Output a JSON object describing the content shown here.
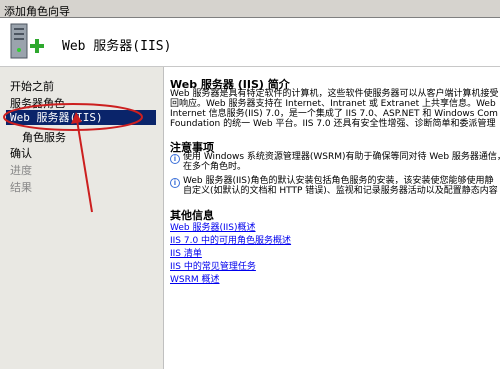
{
  "window": {
    "title": "添加角色向导"
  },
  "header": {
    "title": "Web 服务器(IIS)"
  },
  "sidebar": {
    "items": [
      {
        "label": "开始之前"
      },
      {
        "label": "服务器角色"
      },
      {
        "label": "Web 服务器(IIS)"
      },
      {
        "label": "角色服务"
      },
      {
        "label": "确认"
      },
      {
        "label": "进度"
      },
      {
        "label": "结果"
      }
    ]
  },
  "main": {
    "intro_title": "Web 服务器 (IIS) 简介",
    "intro_lines": [
      "Web 服务器是具有特定软件的计算机，这些软件使服务器可以从客户端计算机接受",
      "回响应。Web 服务器支持在 Internet、Intranet 或 Extranet 上共享信息。Web",
      "Internet 信息服务(IIS) 7.0，是一个集成了 IIS 7.0、ASP.NET 和 Windows Com",
      "Foundation 的统一 Web 平台。IIS 7.0 还具有安全性增强、诊断简单和委派管理"
    ],
    "notes_title": "注意事项",
    "notes": [
      {
        "lines": [
          "使用 Windows 系统资源管理器(WSRM)有助于确保等同对待 Web 服务器通信，",
          "在多个角色时。"
        ]
      },
      {
        "lines": [
          "Web 服务器(IIS)角色的默认安装包括角色服务的安装，该安装使您能够使用静",
          "自定义(如默认的文档和 HTTP 错误)、监视和记录服务器活动以及配置静态内容"
        ]
      }
    ],
    "more_title": "其他信息",
    "links": [
      {
        "label": "Web 服务器(IIS)概述"
      },
      {
        "label": "IIS 7.0 中的可用角色服务概述"
      },
      {
        "label": "IIS 清单"
      },
      {
        "label": "IIS 中的常见管理任务"
      },
      {
        "label": "WSRM 概述"
      }
    ]
  },
  "colors": {
    "selection": "#0a246a",
    "annotation": "#cc1f1f",
    "link": "#0000ee",
    "sidebar_bg": "#e9e8e3"
  }
}
